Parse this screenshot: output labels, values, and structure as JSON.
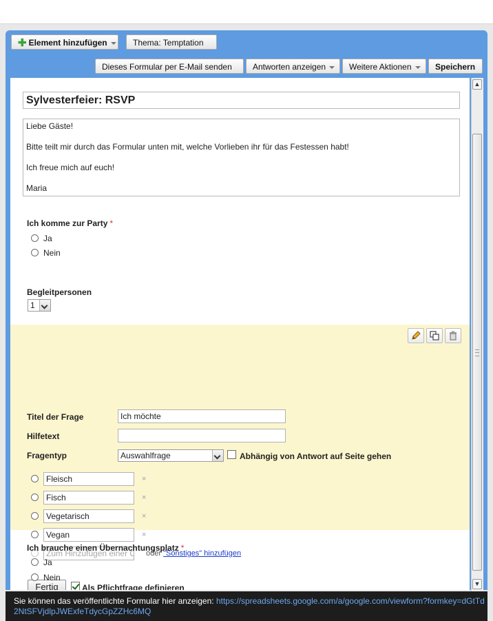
{
  "toolbar": {
    "add_element": "Element hinzufügen",
    "theme": "Thema:  Temptation",
    "email_form": "Dieses Formular per E-Mail senden",
    "show_responses": "Antworten anzeigen",
    "more_actions": "Weitere Aktionen",
    "save": "Speichern"
  },
  "form": {
    "title": "Sylvesterfeier: RSVP",
    "description": [
      "Liebe Gäste!",
      "Bitte teilt mir durch das Formular unten mit, welche Vorlieben ihr für das Festessen habt!",
      "Ich freue mich auf euch!",
      "Maria"
    ]
  },
  "questions": {
    "q1": {
      "title": "Ich komme zur Party",
      "required_mark": "*",
      "options": [
        "Ja",
        "Nein"
      ]
    },
    "q2": {
      "title": "Begleitpersonen",
      "selected": "1"
    },
    "q4": {
      "title": "Ich brauche einen Übernachtungsplatz",
      "required_mark": "*",
      "options": [
        "Ja",
        "Nein"
      ]
    }
  },
  "editor": {
    "title_label": "Titel der Frage",
    "title_value": "Ich möchte",
    "help_label": "Hilfetext",
    "help_value": "",
    "type_label": "Fragentyp",
    "type_value": "Auswahlfrage",
    "goto_page_label": "Abhängig von Antwort auf Seite gehen",
    "goto_page_checked": false,
    "answers": [
      "Fleisch",
      "Fisch",
      "Vegetarisch",
      "Vegan"
    ],
    "remove_glyph": "×",
    "add_placeholder": "Zum Hinzufügen einer O",
    "or_text": "oder",
    "add_other_link": "\"Sonstiges\" hinzufügen",
    "done_button": "Fertig",
    "required_label": "Als Pflichtfrage definieren",
    "required_checked": true,
    "icons": [
      "pencil-icon",
      "duplicate-icon",
      "trash-icon"
    ]
  },
  "footer": {
    "text": "Sie können das veröffentlichte Formular hier anzeigen:",
    "link": "https://spreadsheets.google.com/a/google.com/viewform?formkey=dGtTd2NtSFVjdlpJWExfeTdycGpZZHc6MQ"
  },
  "colors": {
    "accent": "#5e9be0",
    "editor_bg": "#fcf6cf",
    "required": "#dd3333",
    "link": "#6ea8ee"
  }
}
